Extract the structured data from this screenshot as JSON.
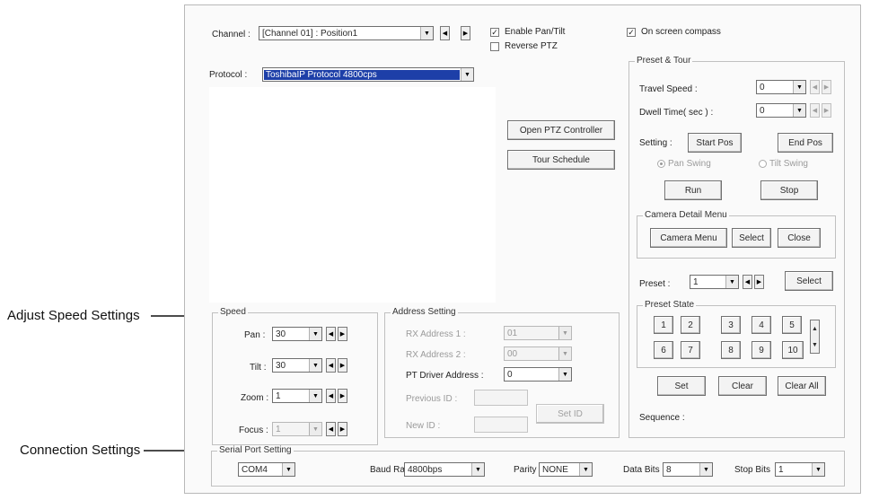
{
  "callouts": {
    "speed": "Adjust Speed Settings",
    "connection": "Connection Settings"
  },
  "top": {
    "channel_label": "Channel :",
    "channel_value": "[Channel 01] : Position1",
    "enable_pantilt": "Enable Pan/Tilt",
    "enable_pantilt_checked": true,
    "reverse_ptz": "Reverse PTZ",
    "reverse_ptz_checked": false,
    "onscreen_compass": "On screen compass",
    "onscreen_compass_checked": true,
    "protocol_label": "Protocol :",
    "protocol_value": "ToshibaIP Protocol 4800cps"
  },
  "buttons": {
    "open_ptz": "Open PTZ Controller",
    "tour_schedule": "Tour Schedule"
  },
  "speed": {
    "title": "Speed",
    "pan_label": "Pan :",
    "pan_value": "30",
    "tilt_label": "Tilt :",
    "tilt_value": "30",
    "zoom_label": "Zoom :",
    "zoom_value": "1",
    "focus_label": "Focus :",
    "focus_value": "1"
  },
  "address": {
    "title": "Address Setting",
    "rx1_label": "RX Address 1 :",
    "rx1_value": "01",
    "rx2_label": "RX Address 2 :",
    "rx2_value": "00",
    "pt_driver_label": "PT Driver Address :",
    "pt_driver_value": "0",
    "previous_id_label": "Previous ID :",
    "new_id_label": "New ID :",
    "set_id": "Set ID"
  },
  "preset_tour": {
    "title": "Preset & Tour",
    "travel_speed_label": "Travel Speed :",
    "travel_speed_value": "0",
    "dwell_time_label": "Dwell Time( sec ) :",
    "dwell_time_value": "0",
    "setting_label": "Setting :",
    "start_pos": "Start Pos",
    "end_pos": "End Pos",
    "pan_swing": "Pan Swing",
    "tilt_swing": "Tilt Swing",
    "run": "Run",
    "stop": "Stop",
    "camera_detail_title": "Camera Detail Menu",
    "camera_menu": "Camera Menu",
    "select": "Select",
    "close": "Close",
    "preset_label": "Preset :",
    "preset_value": "1",
    "preset_select": "Select",
    "preset_state_title": "Preset State",
    "preset_numbers": [
      "1",
      "2",
      "3",
      "4",
      "5",
      "6",
      "7",
      "8",
      "9",
      "10"
    ],
    "set": "Set",
    "clear": "Clear",
    "clear_all": "Clear All",
    "sequence_label": "Sequence :"
  },
  "serial": {
    "title": "Serial Port Setting",
    "port_value": "COM4",
    "baud_label": "Baud Rate",
    "baud_value": "4800bps",
    "parity_label": "Parity",
    "parity_value": "NONE",
    "databits_label": "Data Bits",
    "databits_value": "8",
    "stopbits_label": "Stop Bits",
    "stopbits_value": "1"
  },
  "glyphs": {
    "dropdown": "▼",
    "left": "◀",
    "right": "▶",
    "up": "▲",
    "down": "▼",
    "check": "✓"
  }
}
